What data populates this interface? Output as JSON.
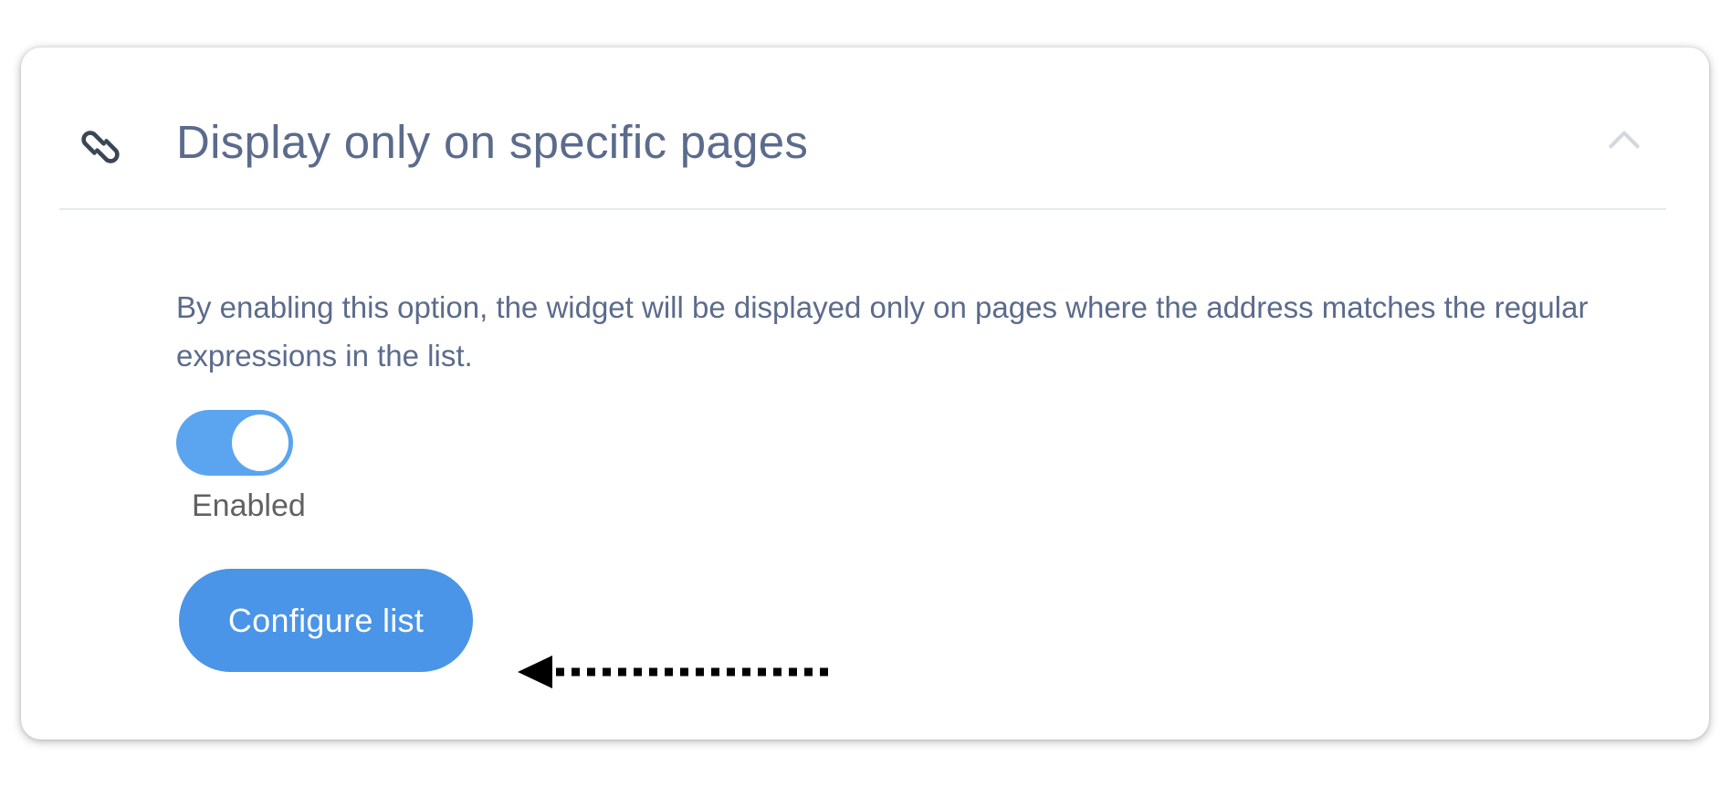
{
  "section": {
    "title": "Display only on specific pages",
    "icon": "link-icon",
    "collapse_icon": "chevron-up-icon",
    "description": "By enabling this option, the widget will be displayed only on pages where the address matches the regular expressions in the list."
  },
  "toggle": {
    "state": "on",
    "label": "Enabled"
  },
  "configure_button": {
    "label": "Configure list"
  },
  "annotation": {
    "icon": "dotted-arrow-left-icon"
  },
  "colors": {
    "text": "#5b6b8c",
    "toggle_on": "#5ba4ef",
    "button": "#4a95e8",
    "label_gray": "#616161",
    "divider": "#e6e9ee"
  }
}
